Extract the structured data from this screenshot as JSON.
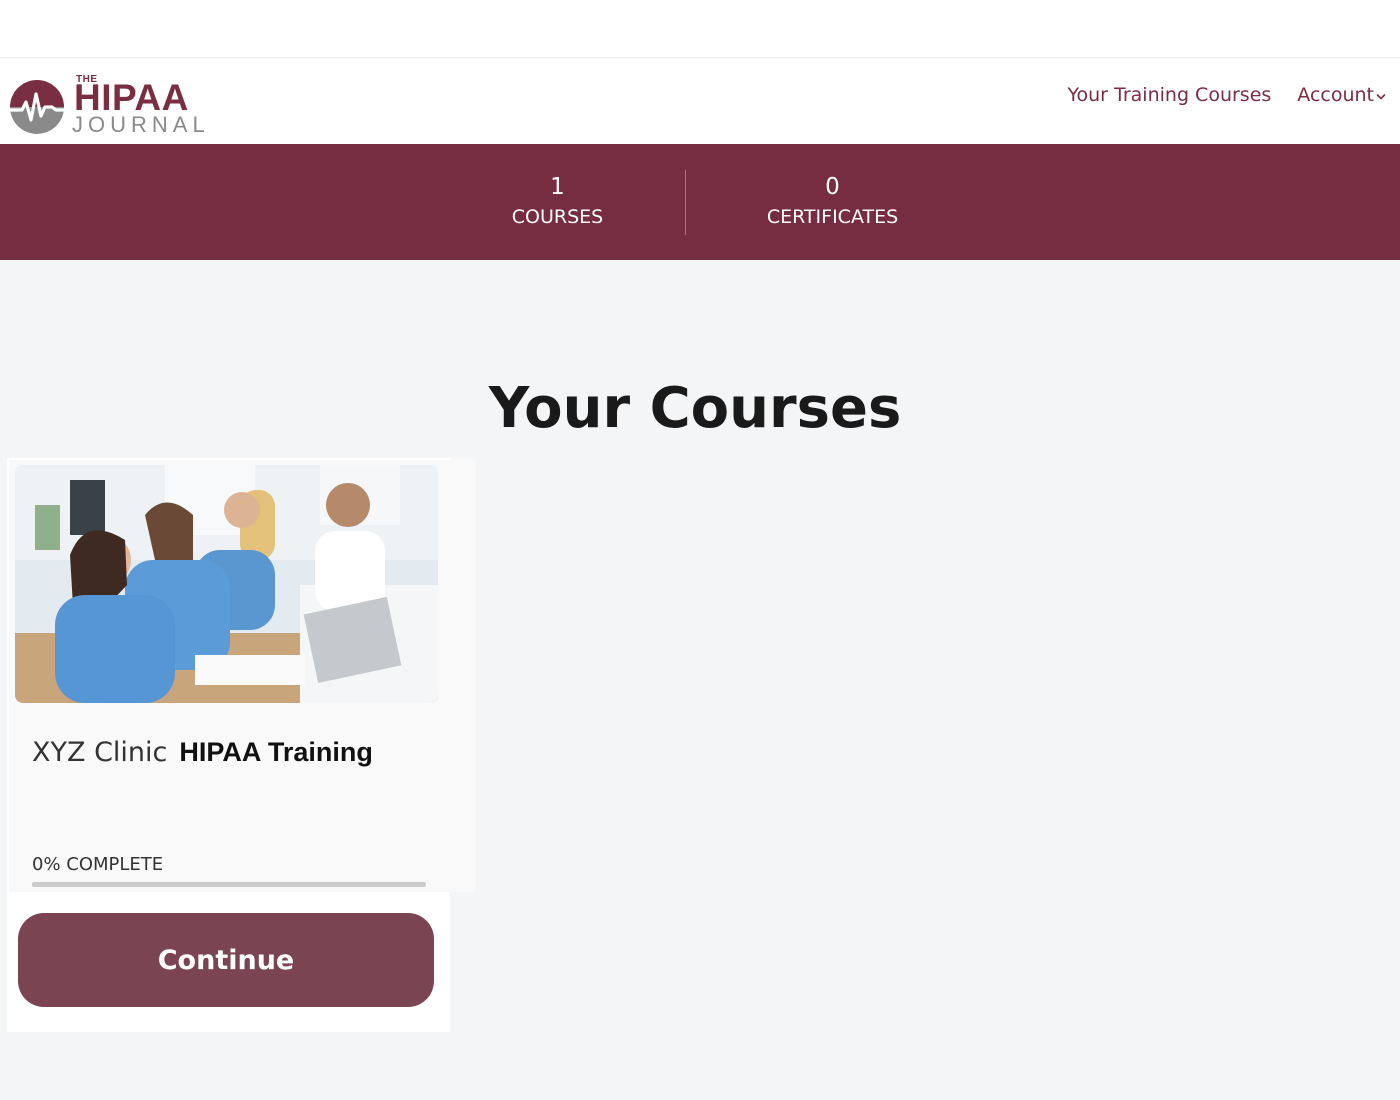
{
  "logo": {
    "the": "THE",
    "brand": "HIPAA",
    "sub": "JOURNAL"
  },
  "nav": {
    "training": "Your Training Courses",
    "account": "Account"
  },
  "stats": {
    "courses_count": "1",
    "courses_label": "COURSES",
    "certificates_count": "0",
    "certificates_label": "CERTIFICATES"
  },
  "page": {
    "title": "Your Courses"
  },
  "course": {
    "organization": "XYZ Clinic",
    "name": "HIPAA Training",
    "progress_percent": 0,
    "progress_label": "0% COMPLETE",
    "button_label": "Continue"
  },
  "colors": {
    "brand": "#762d42",
    "button": "#7a4452",
    "logo_gray": "#8a8a8a"
  },
  "icons": {
    "logo_mark": "heartbeat-icon",
    "account_chevron": "chevron-down-icon"
  }
}
